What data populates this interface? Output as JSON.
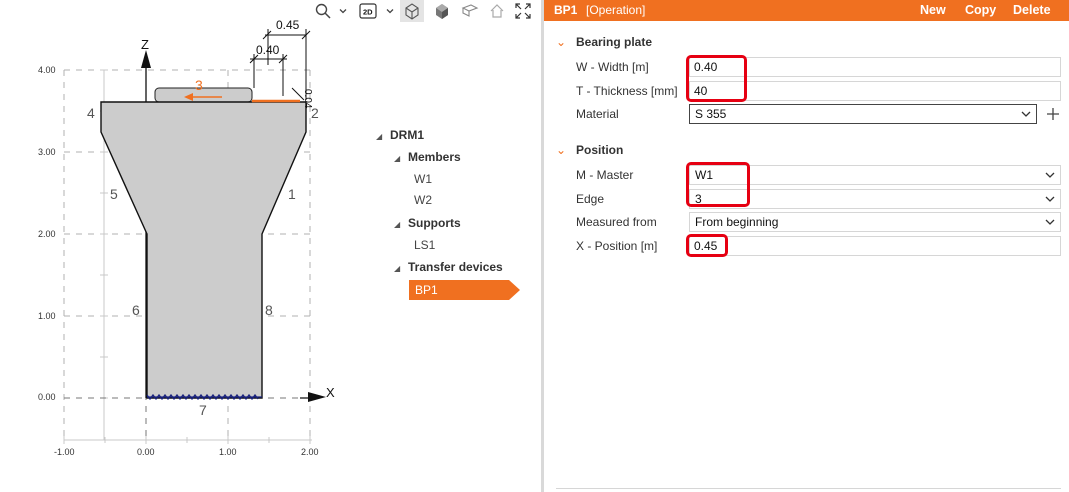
{
  "canvas": {
    "axis_x_label": "X",
    "axis_z_label": "Z",
    "x_ticks": [
      "-1.00",
      "0.00",
      "1.00",
      "2.00"
    ],
    "z_ticks": [
      "0.00",
      "1.00",
      "2.00",
      "3.00",
      "4.00"
    ],
    "edge_numbers": [
      "1",
      "2",
      "3",
      "4",
      "5",
      "6",
      "7",
      "8"
    ],
    "dim_width": "0.45",
    "dim_plate": "0.40",
    "dim_side": "0.04",
    "colors": {
      "shape_fill": "#cccccc",
      "accent": "#f07020",
      "support": "#1a237e"
    }
  },
  "toolbar": {
    "view_2d_label": "2D",
    "icons": [
      "search-icon",
      "chevron-down-icon",
      "view-2d-icon",
      "wireframe-cube-icon",
      "solid-cube-icon",
      "plane-icon",
      "home-icon",
      "fit-view-icon"
    ]
  },
  "tree": {
    "root": "DRM1",
    "members_label": "Members",
    "members": [
      "W1",
      "W2"
    ],
    "supports_label": "Supports",
    "supports": [
      "LS1"
    ],
    "transfer_label": "Transfer devices",
    "transfer": [
      "BP1"
    ]
  },
  "panel": {
    "title": "BP1",
    "subtitle": "[Operation]",
    "buttons": {
      "new": "New",
      "copy": "Copy",
      "delete": "Delete"
    },
    "header_color": "#f07020",
    "bearing_plate": {
      "title": "Bearing plate",
      "width_label": "W - Width [m]",
      "width_value": "0.40",
      "thickness_label": "T - Thickness [mm]",
      "thickness_value": "40",
      "material_label": "Material",
      "material_value": "S 355"
    },
    "position": {
      "title": "Position",
      "master_label": "M - Master",
      "master_value": "W1",
      "edge_label": "Edge",
      "edge_value": "3",
      "measured_label": "Measured from",
      "measured_value": "From beginning",
      "xpos_label": "X - Position [m]",
      "xpos_value": "0.45"
    },
    "highlight_color": "#e60012"
  }
}
